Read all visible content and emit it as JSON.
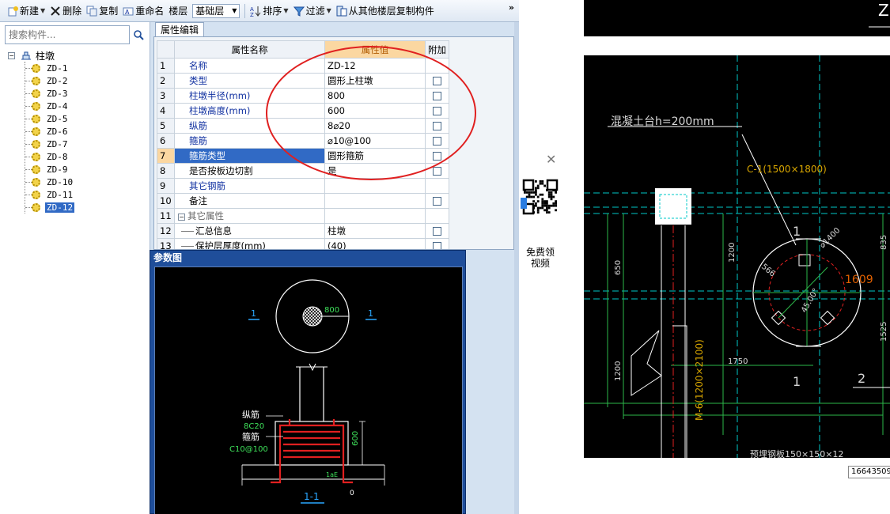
{
  "toolbar": {
    "new_label": "新建",
    "delete_label": "删除",
    "copy_label": "复制",
    "rename_label": "重命名",
    "floor_label": "楼层",
    "floor_value": "基础层",
    "sort_label": "排序",
    "filter_label": "过滤",
    "copy_from_floor_label": "从其他楼层复制构件",
    "more_label": "»"
  },
  "search": {
    "placeholder": "搜索构件..."
  },
  "tree": {
    "root_label": "柱墩",
    "items": [
      "ZD-1",
      "ZD-2",
      "ZD-3",
      "ZD-4",
      "ZD-5",
      "ZD-6",
      "ZD-7",
      "ZD-8",
      "ZD-9",
      "ZD-10",
      "ZD-11",
      "ZD-12"
    ],
    "selected": "ZD-12"
  },
  "properties": {
    "tab_label": "属性编辑",
    "headers": {
      "name": "属性名称",
      "value": "属性值",
      "extra": "附加"
    },
    "rows": [
      {
        "num": "1",
        "name": "名称",
        "value": "ZD-12",
        "checkbox": false
      },
      {
        "num": "2",
        "name": "类型",
        "value": "圆形上柱墩",
        "checkbox": true
      },
      {
        "num": "3",
        "name": "柱墩半径(mm)",
        "value": "800",
        "checkbox": true
      },
      {
        "num": "4",
        "name": "柱墩高度(mm)",
        "value": "600",
        "checkbox": true
      },
      {
        "num": "5",
        "name": "纵筋",
        "value": "8⌀20",
        "checkbox": true
      },
      {
        "num": "6",
        "name": "箍筋",
        "value": "⌀10@100",
        "checkbox": true
      },
      {
        "num": "7",
        "name": "箍筋类型",
        "value": "圆形箍筋",
        "checkbox": true
      },
      {
        "num": "8",
        "name": "是否按板边切割",
        "value": "是",
        "checkbox": true
      },
      {
        "num": "9",
        "name": "其它钢筋",
        "value": "",
        "checkbox": false
      },
      {
        "num": "10",
        "name": "备注",
        "value": "",
        "checkbox": true
      },
      {
        "num": "11",
        "name": "其它属性",
        "value": "",
        "checkbox": false
      },
      {
        "num": "12",
        "name": "汇总信息",
        "value": "柱墩",
        "checkbox": true
      },
      {
        "num": "13",
        "name": "保护层厚度(mm)",
        "value": "(40)",
        "checkbox": true
      }
    ],
    "selected_row": "7"
  },
  "diagram": {
    "title": "参数图",
    "radius_label": "800",
    "section_mark": "1",
    "long_bar_label": "纵筋",
    "long_bar_spec": "8C20",
    "stirrup_label": "箍筋",
    "stirrup_spec": "C10@100",
    "height_label": "600",
    "anchor_label": "1aE",
    "cover_label": "0",
    "section_title": "1-1"
  },
  "ad": {
    "text_line1": "免费领",
    "text_line2": "视频"
  },
  "cad": {
    "thickness_note": "混凝土台h=200mm",
    "callout": "C-1(1500×1800)",
    "dim_1200_vertical": "1200",
    "dim_650": "650",
    "dim_1200_left": "1200",
    "dim_1750": "1750",
    "dim_1525": "1525",
    "dim_835": "835",
    "diameter_label": "⌀1400",
    "radial_label": "566",
    "angle_label": "45.00°",
    "mark_1": "1",
    "mark_2": "2",
    "mark_1609": "1609",
    "beam_label": "M-6(1200×2100)",
    "bottom_note": "预埋钢板150×150×12",
    "top_mark": "Z"
  },
  "image_id": "16643509",
  "colors": {
    "accent": "#316ac5",
    "highlight_circle": "#e02020",
    "property_value_header": "#fbd7a1",
    "diagram_rebar": "#e02020",
    "cad_cyan": "#00c8c8",
    "cad_green": "#2db84a"
  }
}
